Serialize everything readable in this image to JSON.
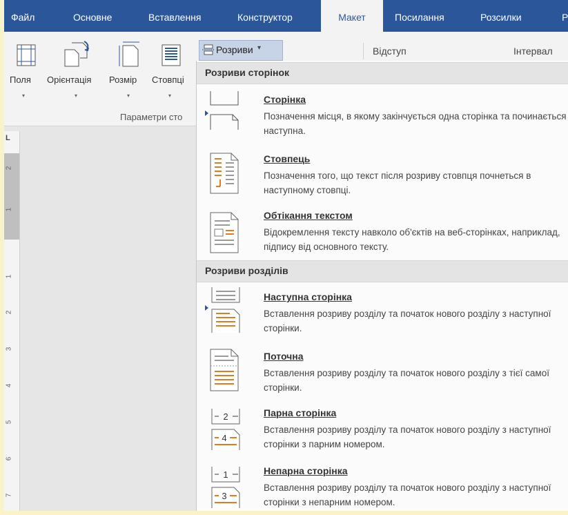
{
  "tabs": [
    "Файл",
    "Основне",
    "Вставлення",
    "Конструктор",
    "Макет",
    "Посилання",
    "Розсилки",
    "Р"
  ],
  "ribbon": {
    "buttons": [
      "Поля",
      "Орієнтація",
      "Розмір",
      "Стовпці"
    ],
    "group_label": "Параметри сто",
    "breaks_label": "Розриви",
    "indent_label": "Відступ",
    "spacing_label": "Інтервал"
  },
  "ruler": {
    "corner": "L",
    "numbers": [
      "2",
      "1",
      "1",
      "2",
      "3",
      "4",
      "5",
      "6",
      "7"
    ]
  },
  "menu": {
    "page_breaks_header": "Розриви сторінок",
    "section_breaks_header": "Розриви розділів",
    "items": [
      {
        "title": "Сторінка",
        "desc": "Позначення місця, в якому закінчується одна сторінка та починається наступна.",
        "icon": "page-break-icon"
      },
      {
        "title": "Стовпець",
        "desc": "Позначення того, що текст після розриву стовпця почнеться в наступному стовпці.",
        "icon": "column-break-icon"
      },
      {
        "title": "Обтікання текстом",
        "desc": "Відокремлення тексту навколо об'єктів на веб-сторінках, наприклад, підпису від основного тексту.",
        "icon": "text-wrapping-break-icon"
      },
      {
        "title": "Наступна сторінка",
        "desc": "Вставлення розриву розділу та початок нового розділу з наступної сторінки.",
        "icon": "next-page-section-icon"
      },
      {
        "title": "Поточна",
        "desc": "Вставлення розриву розділу та початок нового розділу з тієї самої сторінки.",
        "icon": "continuous-section-icon"
      },
      {
        "title": "Парна сторінка",
        "desc": "Вставлення розриву розділу та початок нового розділу з наступної сторінки з парним номером.",
        "icon": "even-page-section-icon"
      },
      {
        "title": "Непарна сторінка",
        "desc": "Вставлення розриву розділу та початок нового розділу з наступної сторінки з непарним номером.",
        "icon": "odd-page-section-icon"
      }
    ],
    "even_icon_numbers": [
      "2",
      "4"
    ],
    "odd_icon_numbers": [
      "1",
      "3"
    ]
  },
  "colors": {
    "accent": "#2b579a",
    "orange": "#e07b24",
    "frame": "#f9f3c9"
  }
}
